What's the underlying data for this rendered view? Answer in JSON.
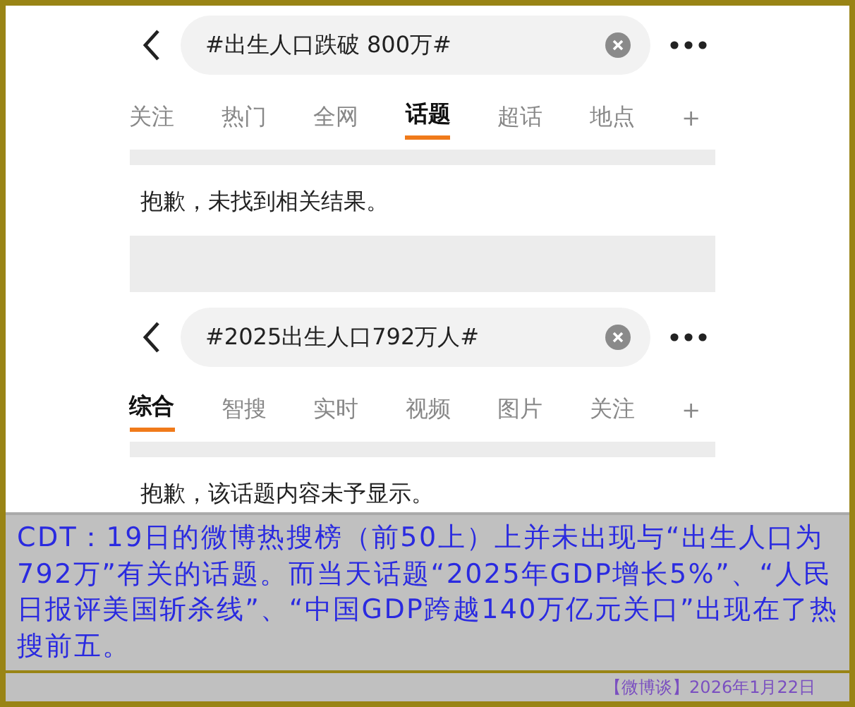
{
  "panels": [
    {
      "query": "#出生人口跌破 800万#",
      "tabs": [
        {
          "label": "关注",
          "selected": false
        },
        {
          "label": "热门",
          "selected": false
        },
        {
          "label": "全网",
          "selected": false
        },
        {
          "label": "话题",
          "selected": true
        },
        {
          "label": "超话",
          "selected": false
        },
        {
          "label": "地点",
          "selected": false
        },
        {
          "label": "+",
          "selected": false
        }
      ],
      "message": "抱歉，未找到相关结果。"
    },
    {
      "query": "#2025出生人口792万人#",
      "tabs": [
        {
          "label": "综合",
          "selected": true
        },
        {
          "label": "智搜",
          "selected": false
        },
        {
          "label": "实时",
          "selected": false
        },
        {
          "label": "视频",
          "selected": false
        },
        {
          "label": "图片",
          "selected": false
        },
        {
          "label": "关注",
          "selected": false
        },
        {
          "label": "+",
          "selected": false
        }
      ],
      "message": "抱歉，该话题内容未予显示。"
    }
  ],
  "caption": "CDT：19日的微博热搜榜（前50上）上并未出现与“出生人口为792万”有关的话题。而当天话题“2025年GDP增长5%”、“人民日报评美国斩杀线”、“中国GDP跨越140万亿元关口”出现在了热搜前五。",
  "source": "【微博谈】2026年1月22日"
}
